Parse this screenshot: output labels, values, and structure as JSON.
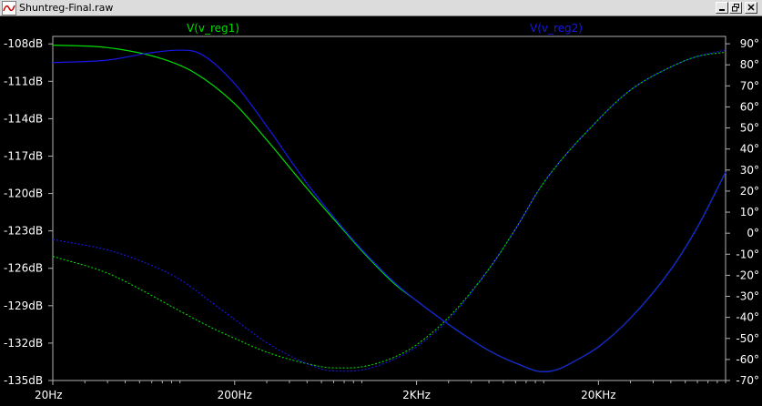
{
  "window": {
    "title": "Shuntreg-Final.raw",
    "icons": {
      "app": "waveform-icon",
      "minimize": "minimize-icon",
      "restore": "restore-icon",
      "close": "close-icon"
    }
  },
  "colors": {
    "background": "#000000",
    "axis": "#b0b0b0",
    "grid": "#707070",
    "tick_text": "#ffffff",
    "reg1": "#00dd00",
    "reg2": "#1818e8"
  },
  "chart_data": {
    "type": "line",
    "title": "",
    "x_scale": "log",
    "xlim": [
      20,
      100000
    ],
    "ylim_left": [
      -135,
      -107.4
    ],
    "ylim_right": [
      -70,
      93.5
    ],
    "x_ticks": [
      {
        "value": 20,
        "label": "20Hz"
      },
      {
        "value": 200,
        "label": "200Hz"
      },
      {
        "value": 2000,
        "label": "2KHz"
      },
      {
        "value": 20000,
        "label": "20KHz"
      }
    ],
    "y_left_ticks": [
      {
        "value": -108,
        "label": "-108dB"
      },
      {
        "value": -111,
        "label": "-111dB"
      },
      {
        "value": -114,
        "label": "-114dB"
      },
      {
        "value": -117,
        "label": "-117dB"
      },
      {
        "value": -120,
        "label": "-120dB"
      },
      {
        "value": -123,
        "label": "-123dB"
      },
      {
        "value": -126,
        "label": "-126dB"
      },
      {
        "value": -129,
        "label": "-129dB"
      },
      {
        "value": -132,
        "label": "-132dB"
      },
      {
        "value": -135,
        "label": "-135dB"
      }
    ],
    "y_right_ticks": [
      {
        "value": 90,
        "label": "90°"
      },
      {
        "value": 80,
        "label": "80°"
      },
      {
        "value": 70,
        "label": "70°"
      },
      {
        "value": 60,
        "label": "60°"
      },
      {
        "value": 50,
        "label": "50°"
      },
      {
        "value": 40,
        "label": "40°"
      },
      {
        "value": 30,
        "label": "30°"
      },
      {
        "value": 20,
        "label": "20°"
      },
      {
        "value": 10,
        "label": "10°"
      },
      {
        "value": 0,
        "label": "0°"
      },
      {
        "value": -10,
        "label": "-10°"
      },
      {
        "value": -20,
        "label": "-20°"
      },
      {
        "value": -30,
        "label": "-30°"
      },
      {
        "value": -40,
        "label": "-40°"
      },
      {
        "value": -50,
        "label": "-50°"
      },
      {
        "value": -60,
        "label": "-60°"
      },
      {
        "value": -70,
        "label": "-70°"
      }
    ],
    "series": [
      {
        "name": "V(v_reg1)",
        "color": "#00dd00",
        "magnitude_db": [
          [
            20,
            -108.1
          ],
          [
            40,
            -108.3
          ],
          [
            80,
            -109.2
          ],
          [
            120,
            -110.3
          ],
          [
            200,
            -112.8
          ],
          [
            300,
            -115.7
          ],
          [
            500,
            -119.6
          ],
          [
            800,
            -123.0
          ],
          [
            1000,
            -124.6
          ],
          [
            1500,
            -127.2
          ],
          [
            2000,
            -128.6
          ],
          [
            3000,
            -130.5
          ],
          [
            5000,
            -132.6
          ],
          [
            7000,
            -133.6
          ],
          [
            10000,
            -134.3
          ],
          [
            12000,
            -134.1
          ],
          [
            15000,
            -133.4
          ],
          [
            20000,
            -132.3
          ],
          [
            30000,
            -130.0
          ],
          [
            50000,
            -126.1
          ],
          [
            70000,
            -122.7
          ],
          [
            100000,
            -118.3
          ]
        ],
        "phase_deg": [
          [
            20,
            -11.0
          ],
          [
            40,
            -19.0
          ],
          [
            60,
            -26.5
          ],
          [
            100,
            -37.0
          ],
          [
            150,
            -45.0
          ],
          [
            200,
            -50.0
          ],
          [
            300,
            -56.5
          ],
          [
            500,
            -62.0
          ],
          [
            700,
            -64.0
          ],
          [
            1000,
            -63.5
          ],
          [
            1500,
            -59.0
          ],
          [
            2000,
            -53.0
          ],
          [
            3000,
            -40.0
          ],
          [
            5000,
            -17.0
          ],
          [
            7000,
            2.0
          ],
          [
            10000,
            24.0
          ],
          [
            20000,
            54.0
          ],
          [
            30000,
            68.0
          ],
          [
            50000,
            79.0
          ],
          [
            70000,
            84.0
          ],
          [
            100000,
            86.0
          ]
        ]
      },
      {
        "name": "V(v_reg2)",
        "color": "#1818e8",
        "magnitude_db": [
          [
            20,
            -109.5
          ],
          [
            40,
            -109.3
          ],
          [
            70,
            -108.7
          ],
          [
            100,
            -108.5
          ],
          [
            130,
            -108.8
          ],
          [
            200,
            -111.2
          ],
          [
            300,
            -114.6
          ],
          [
            500,
            -119.2
          ],
          [
            800,
            -122.9
          ],
          [
            1000,
            -124.5
          ],
          [
            1500,
            -127.1
          ],
          [
            2000,
            -128.6
          ],
          [
            3000,
            -130.5
          ],
          [
            5000,
            -132.6
          ],
          [
            7000,
            -133.6
          ],
          [
            10000,
            -134.3
          ],
          [
            12000,
            -134.1
          ],
          [
            15000,
            -133.4
          ],
          [
            20000,
            -132.3
          ],
          [
            30000,
            -130.0
          ],
          [
            50000,
            -126.1
          ],
          [
            70000,
            -122.7
          ],
          [
            100000,
            -118.3
          ]
        ],
        "phase_deg": [
          [
            20,
            -3.0
          ],
          [
            40,
            -8.0
          ],
          [
            60,
            -13.0
          ],
          [
            100,
            -22.0
          ],
          [
            150,
            -33.0
          ],
          [
            200,
            -41.0
          ],
          [
            300,
            -52.0
          ],
          [
            500,
            -62.0
          ],
          [
            700,
            -65.5
          ],
          [
            1000,
            -65.0
          ],
          [
            1500,
            -60.0
          ],
          [
            2000,
            -54.0
          ],
          [
            3000,
            -41.0
          ],
          [
            5000,
            -17.0
          ],
          [
            7000,
            2.0
          ],
          [
            10000,
            24.0
          ],
          [
            20000,
            54.0
          ],
          [
            30000,
            68.0
          ],
          [
            50000,
            79.0
          ],
          [
            70000,
            84.0
          ],
          [
            100000,
            87.0
          ]
        ]
      }
    ]
  }
}
